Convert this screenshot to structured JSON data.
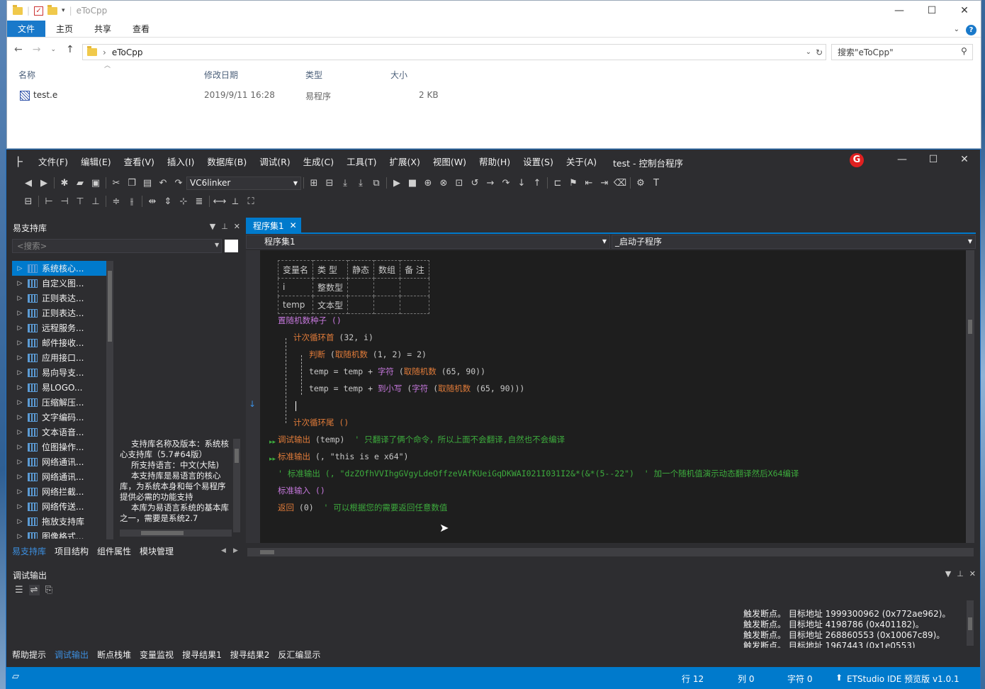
{
  "explorer": {
    "title": "eToCpp",
    "ribbon": [
      "文件",
      "主页",
      "共享",
      "查看"
    ],
    "help": "?",
    "path": "eToCpp",
    "search_placeholder": "搜索\"eToCpp\"",
    "columns": {
      "name": "名称",
      "modified": "修改日期",
      "type": "类型",
      "size": "大小"
    },
    "file": {
      "name": "test.e",
      "modified": "2019/9/11 16:28",
      "type": "易程序",
      "size": "2 KB"
    }
  },
  "ide": {
    "menu": [
      "文件(F)",
      "编辑(E)",
      "查看(V)",
      "插入(I)",
      "数据库(B)",
      "调试(R)",
      "生成(C)",
      "工具(T)",
      "扩展(X)",
      "视图(W)",
      "帮助(H)",
      "设置(S)",
      "关于(A)"
    ],
    "title": "test - 控制台程序",
    "badge": "G",
    "linker": "VC6linker",
    "lib_panel": {
      "title": "易支持库",
      "search": "<搜索>",
      "items": [
        "系统核心...",
        "自定义图...",
        "正则表达...",
        "正则表达...",
        "远程服务...",
        "邮件接收...",
        "应用接口...",
        "易向导支...",
        "易LOGO...",
        "压缩解压...",
        "文字编码...",
        "文本语音...",
        "位图操作...",
        "网络通讯...",
        "网络通讯...",
        "网络拦截...",
        "网络传送...",
        "拖放支持库",
        "图像格式..."
      ],
      "desc": [
        "支持库名称及版本：系统核心支持库（5.7#64版）",
        "所支持语言：中文(大陆)",
        "本支持库是易语言的核心库，为系统本身和每个易程序提供必需的功能支持",
        "本库为易语言系统的基本库之一，需要是系统2.7"
      ],
      "tabs": [
        "易支持库",
        "项目结构",
        "组件属性",
        "模块管理"
      ]
    },
    "editor": {
      "tab": "程序集1",
      "combo_left": "程序集1",
      "combo_right": "_启动子程序",
      "var_header": [
        "变量名",
        "类 型",
        "静态",
        "数组",
        "备 注"
      ],
      "vars": [
        [
          "i",
          "整数型"
        ],
        [
          "temp",
          "文本型"
        ]
      ],
      "lines": {
        "l1": "置随机数种子 ()",
        "l2a": "计次循环首",
        "l2b": " (32, i)",
        "l3a": "判断",
        "l3b": " (",
        "l3c": "取随机数",
        "l3d": " (1, 2) = 2)",
        "l4a": "temp = temp + ",
        "l4b": "字符",
        "l4c": " (",
        "l4d": "取随机数",
        "l4e": " (65, 90))",
        "l5a": "temp = temp + ",
        "l5b": "到小写",
        "l5c": " (",
        "l5d": "字符",
        "l5e": " (",
        "l5f": "取随机数",
        "l5g": " (65, 90)))",
        "l6": "计次循环尾 ()",
        "l7a": "调试输出",
        "l7b": " (temp)",
        "l7c": "  ' 只翻译了俩个命令，所以上面不会翻译,自然也不会编译",
        "l8a": "标准输出",
        "l8b": " (, \"this is e x64\")",
        "l9": "' 标准输出 (, \"dzZOfhVVIhgGVgyLdeOffzeVAfKUeiGqDKWAI021I031I2&*(&*(5--22\")  ' 加一个随机值演示动态翻译然后X64编译",
        "l10": "标准输入 ()",
        "l11a": "返回",
        "l11b": " (0)",
        "l11c": "  ' 可以根据您的需要返回任意数值"
      }
    },
    "debug": {
      "title": "调试输出",
      "output": [
        "触发断点。 目标地址 1999300962 (0x772ae962)。",
        "触发断点。 目标地址 4198786 (0x401182)。",
        "触发断点。 目标地址 268860553 (0x10067c89)。",
        "触发断点。 目标地址 1967443 (0x1e0553)"
      ],
      "tabs": [
        "帮助提示",
        "调试输出",
        "断点栈堆",
        "变量监视",
        "搜寻结果1",
        "搜寻结果2",
        "反汇编显示"
      ]
    },
    "status": {
      "line": "行 12",
      "col": "列 0",
      "char": "字符 0",
      "product": "ETStudio IDE 预览版 v1.0.1"
    }
  }
}
